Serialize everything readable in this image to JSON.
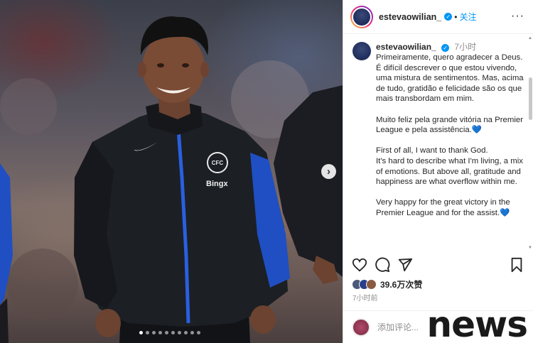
{
  "post": {
    "username": "estevaowilian_",
    "follow_label": "关注",
    "more_label": "···",
    "separator": "•",
    "caption_time": "7小时",
    "caption_paragraphs": [
      "Primeiramente, quero agradecer a Deus.\nÉ difícil descrever o que estou vivendo, uma mistura de sentimentos. Mas, acima de tudo, gratidão e felicidade são os que mais transbordam em mim.",
      "Muito feliz pela grande vitória na Premier League e pela assistência.💙",
      "First of all, I want to thank God.\nIt's hard to describe what I'm living, a mix of emotions. But above all, gratitude and happiness are what overflow within me.",
      "Very happy for the great victory in the Premier League and for the assist.💙"
    ],
    "likes": "39.6万次赞",
    "timestamp": "7小时前",
    "comment_placeholder": "添加评论..."
  },
  "photo": {
    "next_icon": "chevron-right-icon",
    "next_label": "›",
    "carousel_count": 10,
    "carousel_active": 0,
    "jersey_sponsor": "Bingx",
    "club_badge": "CFC"
  },
  "watermark": "news",
  "colors": {
    "accent": "#0095f6",
    "jacket": "#1c1f24",
    "jacket_blue": "#1f4fc2"
  }
}
